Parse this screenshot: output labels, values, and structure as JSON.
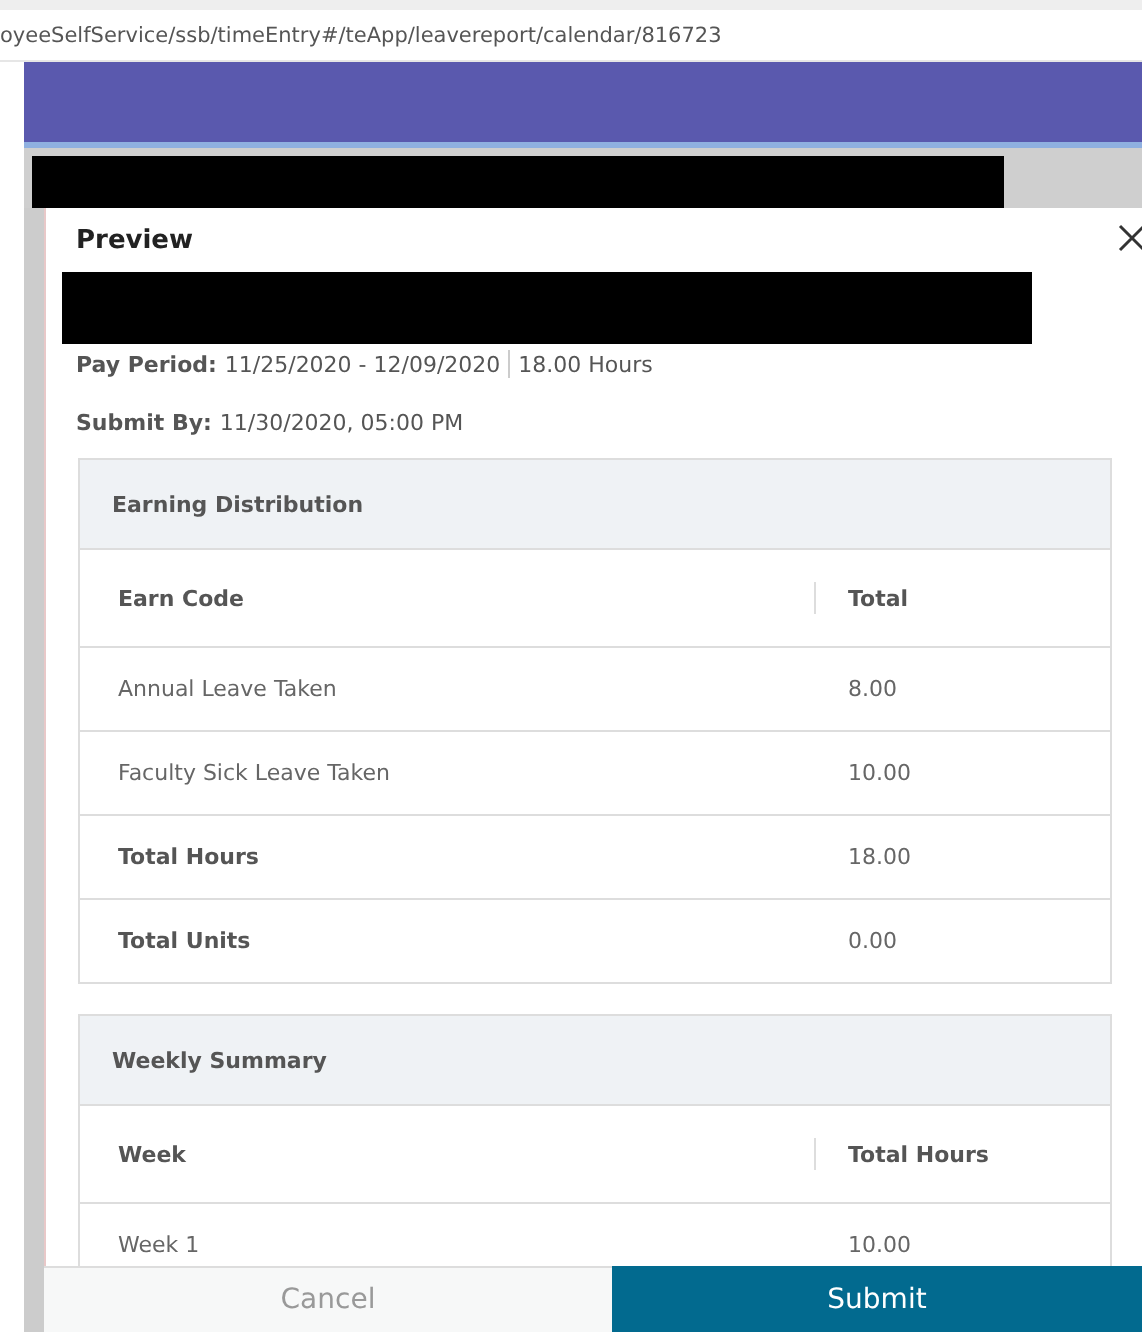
{
  "address_bar": {
    "url": "oyeeSelfService/ssb/timeEntry#/teApp/leavereport/calendar/816723"
  },
  "dialog": {
    "title": "Preview",
    "pay_period": {
      "label": "Pay Period:",
      "value": "11/25/2020 - 12/09/2020",
      "hours": "18.00 Hours"
    },
    "submit_by": {
      "label": "Submit By:",
      "value": "11/30/2020, 05:00 PM"
    },
    "sections": [
      {
        "title": "Earning Distribution",
        "columns": [
          "Earn Code",
          "Total"
        ],
        "rows": [
          {
            "cells": [
              "Annual Leave Taken",
              "8.00"
            ],
            "bold": false
          },
          {
            "cells": [
              "Faculty Sick Leave Taken",
              "10.00"
            ],
            "bold": false
          },
          {
            "cells": [
              "Total Hours",
              "18.00"
            ],
            "bold": true
          },
          {
            "cells": [
              "Total Units",
              "0.00"
            ],
            "bold": true
          }
        ]
      },
      {
        "title": "Weekly Summary",
        "columns": [
          "Week",
          "Total Hours"
        ],
        "rows": [
          {
            "cells": [
              "Week 1",
              "10.00"
            ],
            "bold": false
          }
        ]
      }
    ],
    "buttons": [
      {
        "label": "Cancel",
        "kind": "secondary"
      },
      {
        "label": "Submit",
        "kind": "primary"
      }
    ]
  }
}
